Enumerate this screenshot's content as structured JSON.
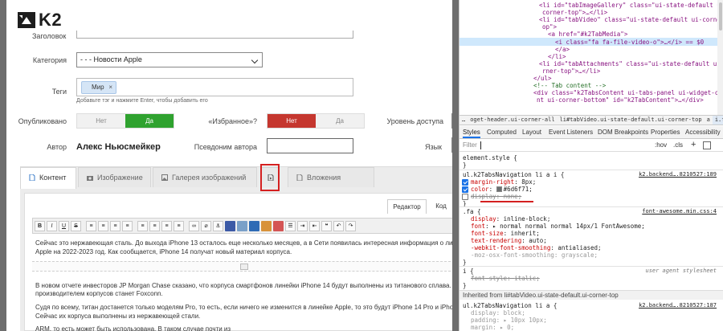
{
  "editor": {
    "logo": "K2",
    "fields": {
      "title_label": "Заголовок",
      "category_label": "Категория",
      "category_value": "- - - Новости Apple",
      "tags_label": "Теги",
      "tag_chip": "Мир",
      "tag_remove": "×",
      "tags_hint": "Добавьте тэг и нажмите Enter, чтобы добавить его",
      "published_label": "Опубликовано",
      "published_no": "Нет",
      "published_yes": "Да",
      "featured_label": "«Избранное»?",
      "featured_no": "Нет",
      "featured_yes": "Да",
      "access_label": "Уровень доступа",
      "author_label": "Автор",
      "author_name": "Алекс Ньюсмейкер",
      "alias_label": "Псевдоним автора",
      "language_label": "Язык"
    },
    "tabs": [
      {
        "label": "Контент"
      },
      {
        "label": "Изображение"
      },
      {
        "label": "Галерея изображений"
      },
      {
        "label": ""
      },
      {
        "label": "Вложения"
      }
    ],
    "editor_tabs": {
      "editor": "Редактор",
      "code": "Код"
    },
    "toolbar": {
      "bold": "B",
      "italic": "I",
      "underline": "U",
      "strike": "S"
    },
    "content": {
      "p1a": "Сейчас это нержавеющая сталь. До выхода iPhone 13 осталось еще несколько месяцев, а в Сети появилась интересная информация о линейке",
      "p1b": "Apple на 2022-2023 год. Как сообщается, iPhone 14 получат новый материал корпуса.",
      "p2a": "В новом отчете инвесторов JP Morgan Chase сказано, что корпуса смартфонов линейки iPhone 14 будут выполнены из титанового сплава. Эксклюзивный",
      "p2b": "производителем корпусов станет Foxconn.",
      "p3a": "Судя по всему, титан достанется только моделям Pro, то есть, если ничего не изменится в линейке Apple, то это будут iPhone 14 Pro и iPhone 14",
      "p3b": "Сейчас их корпуса выполнены из нержавеющей стали.",
      "p4": "ARM, то есть может быть использована. В таком случае почти из"
    }
  },
  "devtools": {
    "dom": {
      "l1a": "<li id=\"tabImageGallery\" class=\"ui-state-default ui-",
      "l1b": "corner-top\">…</li>",
      "l2a": "<li id=\"tabVideo\" class=\"ui-state-default ui-corner-t",
      "l2b": "op\">",
      "l3": "<a href=\"#k2TabMedia\">",
      "l4": "<i class=\"fa fa-file-video-o\">…</i> == $0",
      "l5": "</a>",
      "l6": "</li>",
      "l7a": "<li id=\"tabAttachments\" class=\"ui-state-default ui-co",
      "l7b": "rner-top\">…</li>",
      "l8": "</ul>",
      "l9": "<!-- Tab content -->",
      "l10a": "<div class=\"k2TabsContent ui-tabs-panel ui-widget-conte",
      "l10b": "nt ui-corner-bottom\" id=\"k2TabContent\">…</div>"
    },
    "breadcrumbs": [
      "…",
      "oget-header.ui-corner-all",
      "li#tabVideo.ui-state-default.ui-corner-top",
      "a",
      "i.fa.fa-file-video-o",
      "…"
    ],
    "tabs": [
      "Styles",
      "Computed",
      "Layout",
      "Event Listeners",
      "DOM Breakpoints",
      "Properties",
      "Accessibility"
    ],
    "filter": {
      "placeholder": "Filter",
      "hov": ":hov",
      "cls": ".cls",
      "plus": "+"
    },
    "rules": {
      "element_style": "element.style {",
      "close": "}",
      "r1_selector": "ul.k2TabsNavigation li a i {",
      "r1_source": "k2.backend….8210527:189",
      "r1_p1": "margin-right",
      "r1_v1": "8px;",
      "r1_p2": "color",
      "r1_v2": "#6d6f71;",
      "r1_p3": "display",
      "r1_v3": "none;",
      "r2_selector": ".fa {",
      "r2_source": "font-awesome.min.css:4",
      "r2_p1": "display",
      "r2_v1": "inline-block;",
      "r2_p2": "font",
      "r2_v2": "normal normal normal 14px/1 FontAwesome;",
      "r2_p3": "font-size",
      "r2_v3": "inherit;",
      "r2_p4": "text-rendering",
      "r2_v4": "auto;",
      "r2_p5": "-webkit-font-smoothing",
      "r2_v5": "antialiased;",
      "r2_p6": "-moz-osx-font-smoothing",
      "r2_v6": "grayscale;",
      "r3_selector": "i {",
      "r3_source": "user agent stylesheet",
      "r3_p1": "font-style",
      "r3_v1": "italic;",
      "inherited": "Inherited from li#tabVideo.ui-state-default.ui-corner-top",
      "r4_selector": "ul.k2TabsNavigation li a {",
      "r4_source": "k2.backend….8210527:187",
      "r4_p1": "display",
      "r4_v1": "block;",
      "r4_p2": "padding",
      "r4_v2": "10px 10px;",
      "r4_p3": "margin",
      "r4_v3": "0;"
    }
  },
  "colors": {
    "toggle_green": "#2fa22f",
    "toggle_red": "#c5372f",
    "highlight_red": "#d42020",
    "devtools_accent": "#1a73e8",
    "swatch": "#6d6f71"
  }
}
